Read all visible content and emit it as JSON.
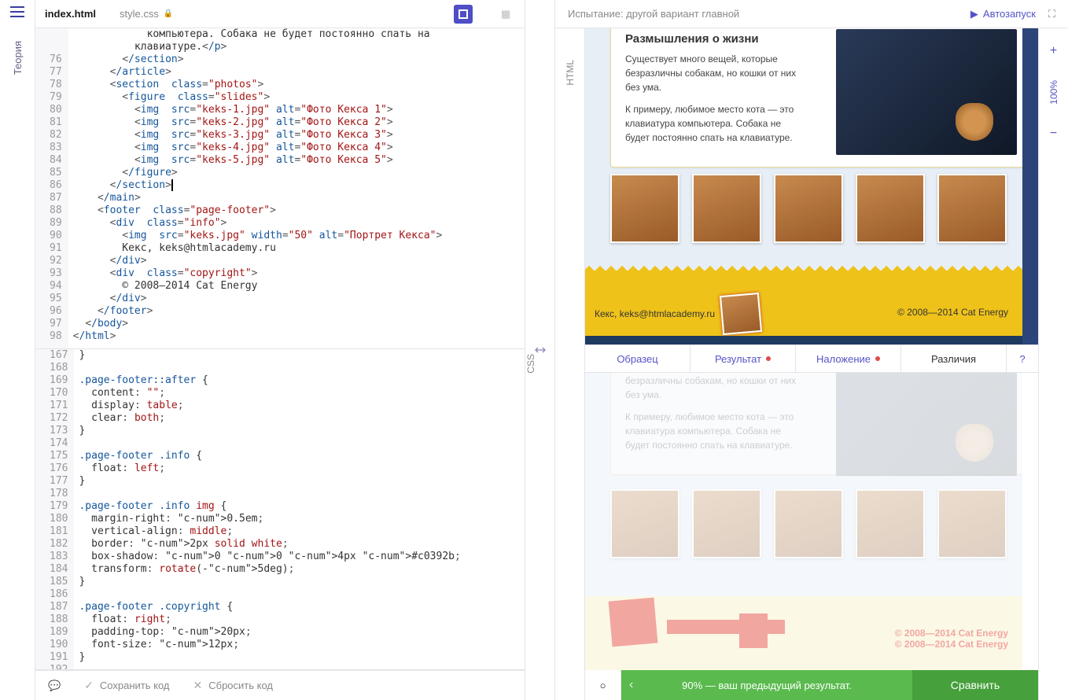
{
  "sidebar": {
    "theory": "Теория"
  },
  "tabs": {
    "html": "index.html",
    "css": "style.css"
  },
  "header": {
    "title": "Испытание: другой вариант главной",
    "autorun": "Автозапуск"
  },
  "zoom": {
    "level": "100%"
  },
  "pane_labels": {
    "html": "HTML",
    "css": "CSS"
  },
  "compare_tabs": {
    "sample": "Образец",
    "result": "Результат",
    "overlay": "Наложение",
    "diff": "Различия",
    "help": "?"
  },
  "bottom": {
    "save": "Сохранить код",
    "reset": "Сбросить код"
  },
  "footer": {
    "score": "90% — ваш предыдущий результат.",
    "compare": "Сравнить"
  },
  "html_lines": [
    {
      "n": "",
      "html": "            компьютера. Собака не будет постоянно спать на"
    },
    {
      "n": "",
      "html": "          клавиатуре.</p>"
    },
    {
      "n": "76",
      "html": "        </section>"
    },
    {
      "n": "77",
      "html": "      </article>"
    },
    {
      "n": "78",
      "html": "      <section class=\"photos\">"
    },
    {
      "n": "79",
      "html": "        <figure class=\"slides\">"
    },
    {
      "n": "80",
      "html": "          <img src=\"keks-1.jpg\" alt=\"Фото Кекса 1\">"
    },
    {
      "n": "81",
      "html": "          <img src=\"keks-2.jpg\" alt=\"Фото Кекса 2\">"
    },
    {
      "n": "82",
      "html": "          <img src=\"keks-3.jpg\" alt=\"Фото Кекса 3\">"
    },
    {
      "n": "83",
      "html": "          <img src=\"keks-4.jpg\" alt=\"Фото Кекса 4\">"
    },
    {
      "n": "84",
      "html": "          <img src=\"keks-5.jpg\" alt=\"Фото Кекса 5\">"
    },
    {
      "n": "85",
      "html": "        </figure>"
    },
    {
      "n": "86",
      "html": "      </section>"
    },
    {
      "n": "87",
      "html": "    </main>"
    },
    {
      "n": "88",
      "html": "    <footer class=\"page-footer\">"
    },
    {
      "n": "89",
      "html": "      <div class=\"info\">"
    },
    {
      "n": "90",
      "html": "        <img src=\"keks.jpg\" width=\"50\" alt=\"Портрет Кекса\">"
    },
    {
      "n": "91",
      "html": "        Кекс, keks@htmlacademy.ru"
    },
    {
      "n": "92",
      "html": "      </div>"
    },
    {
      "n": "93",
      "html": "      <div class=\"copyright\">"
    },
    {
      "n": "94",
      "html": "        © 2008–2014 Cat Energy"
    },
    {
      "n": "95",
      "html": "      </div>"
    },
    {
      "n": "96",
      "html": "    </footer>"
    },
    {
      "n": "97",
      "html": "  </body>"
    },
    {
      "n": "98",
      "html": "</html>"
    }
  ],
  "css_lines": [
    {
      "n": "167",
      "css": "}"
    },
    {
      "n": "168",
      "css": ""
    },
    {
      "n": "169",
      "css": ".page-footer::after {"
    },
    {
      "n": "170",
      "css": "  content: \"\";"
    },
    {
      "n": "171",
      "css": "  display: table;"
    },
    {
      "n": "172",
      "css": "  clear: both;"
    },
    {
      "n": "173",
      "css": "}"
    },
    {
      "n": "174",
      "css": ""
    },
    {
      "n": "175",
      "css": ".page-footer .info {"
    },
    {
      "n": "176",
      "css": "  float: left;"
    },
    {
      "n": "177",
      "css": "}"
    },
    {
      "n": "178",
      "css": ""
    },
    {
      "n": "179",
      "css": ".page-footer .info img {"
    },
    {
      "n": "180",
      "css": "  margin-right: 0.5em;"
    },
    {
      "n": "181",
      "css": "  vertical-align: middle;"
    },
    {
      "n": "182",
      "css": "  border: 2px solid white;"
    },
    {
      "n": "183",
      "css": "  box-shadow: 0 0 4px #c0392b;"
    },
    {
      "n": "184",
      "css": "  transform: rotate(-5deg);"
    },
    {
      "n": "185",
      "css": "}"
    },
    {
      "n": "186",
      "css": ""
    },
    {
      "n": "187",
      "css": ".page-footer .copyright {"
    },
    {
      "n": "188",
      "css": "  float: right;"
    },
    {
      "n": "189",
      "css": "  padding-top: 20px;"
    },
    {
      "n": "190",
      "css": "  font-size: 12px;"
    },
    {
      "n": "191",
      "css": "}"
    },
    {
      "n": "192",
      "css": ""
    }
  ],
  "preview": {
    "article": {
      "title": "Размышления о жизни",
      "p1": "Существует много вещей, которые безразличны собакам, но кошки от них без ума.",
      "p2": "К примеру, любимое место кота — это клавиатура компьютера. Собака не будет постоянно спать на клавиатуре."
    },
    "footer": {
      "info": "Кекс, keks@htmlacademy.ru",
      "copyright": "© 2008—2014 Cat Energy"
    }
  },
  "diff": {
    "info_overlap": "Кекс, keks@htmlacademy.ru",
    "copyright": "© 2008—2014 Cat Energy"
  }
}
